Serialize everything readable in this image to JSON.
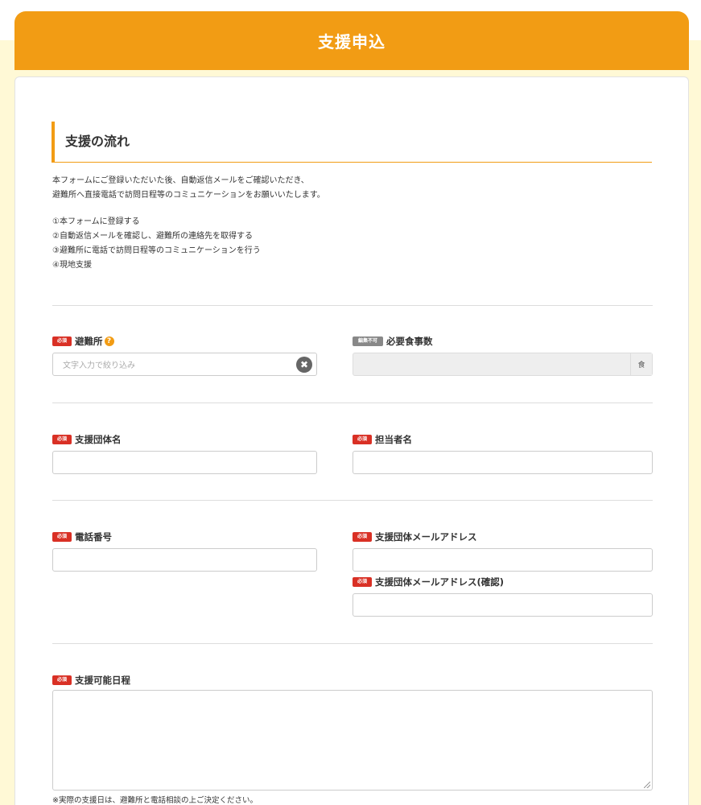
{
  "header": {
    "title": "支援申込"
  },
  "flow": {
    "title": "支援の流れ",
    "intro_lines": [
      "本フォームにご登録いただいた後、自動返信メールをご確認いただき、",
      "避難所へ直接電話で訪問日程等のコミュニケーションをお願いいたします。"
    ],
    "steps": [
      "①本フォームに登録する",
      "②自動返信メールを確認し、避難所の連絡先を取得する",
      "③避難所に電話で訪問日程等のコミュニケーションを行う",
      "④現地支援"
    ]
  },
  "badges": {
    "required": "必須",
    "readonly": "編集不可"
  },
  "fields": {
    "shelter": {
      "label": "避難所",
      "placeholder": "文字入力で絞り込み",
      "help_icon": "?",
      "clear_icon": "✖"
    },
    "meals": {
      "label": "必要食事数",
      "suffix": "食"
    },
    "org_name": {
      "label": "支援団体名"
    },
    "contact_person": {
      "label": "担当者名"
    },
    "phone": {
      "label": "電話番号"
    },
    "email": {
      "label": "支援団体メールアドレス"
    },
    "email_confirm": {
      "label": "支援団体メールアドレス(確認)"
    },
    "schedule": {
      "label": "支援可能日程",
      "note": "※実際の支援日は、避難所と電話相談の上ご決定ください。"
    }
  },
  "colors": {
    "accent": "#f29c14",
    "required": "#d93025",
    "readonly": "#888888"
  }
}
